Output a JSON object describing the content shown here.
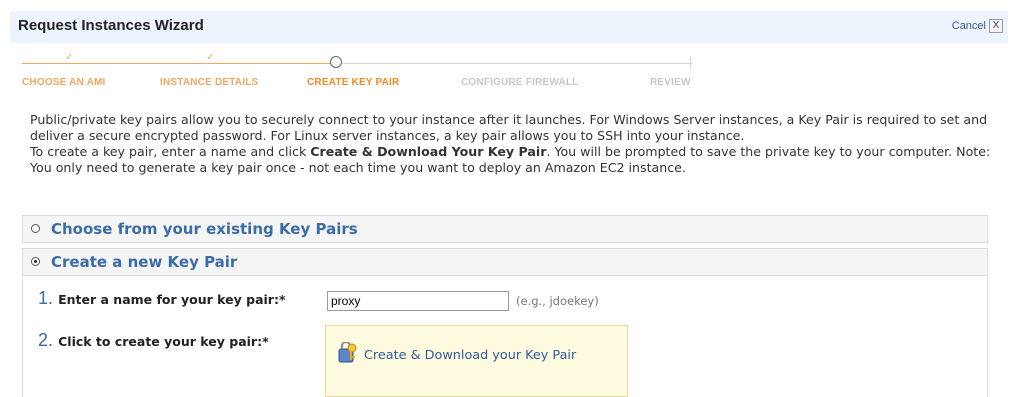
{
  "wizard": {
    "title": "Request Instances Wizard",
    "cancel_label": "Cancel",
    "close_glyph": "X"
  },
  "steps": [
    {
      "label": "CHOOSE AN AMI",
      "status": "done"
    },
    {
      "label": "INSTANCE DETAILS",
      "status": "done"
    },
    {
      "label": "CREATE KEY PAIR",
      "status": "current"
    },
    {
      "label": "CONFIGURE FIREWALL",
      "status": "upcoming"
    },
    {
      "label": "REVIEW",
      "status": "upcoming"
    }
  ],
  "description": {
    "paragraph1": "Public/private key pairs allow you to securely connect to your instance after it launches. For Windows Server instances, a Key Pair is required to set and deliver a secure encrypted password. For Linux server instances, a key pair allows you to SSH into your instance.",
    "paragraph2_prefix": "To create a key pair, enter a name and click ",
    "paragraph2_bold": "Create & Download Your Key Pair",
    "paragraph2_suffix": ". You will be prompted to save the private key to your computer. Note: You only need to generate a key pair once - not each time you want to deploy an Amazon EC2 instance."
  },
  "options": {
    "existing_label": "Choose from your existing Key Pairs",
    "new_label": "Create a new Key Pair",
    "selected": "new"
  },
  "form": {
    "step1_number": "1.",
    "step1_label": "Enter a name for your key pair:*",
    "key_name_value": "proxy",
    "key_name_hint": "(e.g., jdoekey)",
    "step2_number": "2.",
    "step2_label": "Click to create your key pair:*",
    "create_button_label": "Create & Download your Key Pair"
  },
  "colors": {
    "accent_orange": "#f08a24",
    "link_blue": "#3a6ca8",
    "highlight_yellow": "#fffbe0"
  },
  "icons": [
    "close-icon",
    "check-icon",
    "key-icon"
  ]
}
